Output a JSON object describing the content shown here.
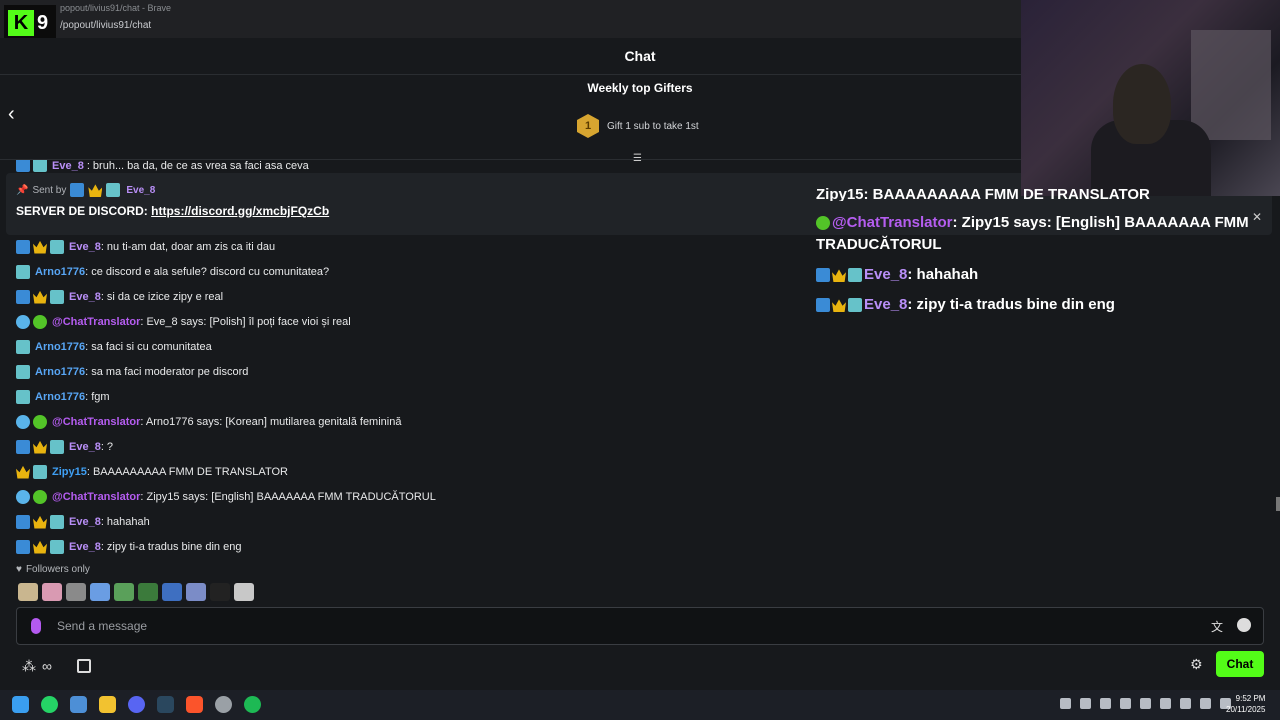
{
  "browser": {
    "title": "popout/livius91/chat - Brave",
    "url": "/popout/livius91/chat",
    "logo_number": "9"
  },
  "header": {
    "title": "Chat"
  },
  "gifters": {
    "title": "Weekly top Gifters",
    "medal": "1",
    "cta": "Gift 1 sub to take 1st"
  },
  "cutoff": {
    "user": "Eve_8",
    "text": ": bruh... ba da, de ce as vrea sa faci asa ceva"
  },
  "pinned": {
    "sent_by": "Sent by",
    "user": "Eve_8",
    "text": "SERVER DE DISCORD: ",
    "link": "https://discord.gg/xmcbjFQzCb"
  },
  "messages": [
    {
      "user": "Eve_8",
      "kind": "eve",
      "text": ": nu ti-am dat, doar am zis ca iti dau"
    },
    {
      "user": "Arno1776",
      "kind": "arno",
      "text": ": ce discord e ala sefule? discord cu comunitatea?"
    },
    {
      "user": "Eve_8",
      "kind": "eve",
      "text": ": si da ce izice zipy e real"
    },
    {
      "user": "@ChatTranslator",
      "kind": "bot",
      "text": ": Eve_8 says: [Polish] îl poți face vioi și real"
    },
    {
      "user": "Arno1776",
      "kind": "arno",
      "text": ": sa faci si cu comunitatea"
    },
    {
      "user": "Arno1776",
      "kind": "arno",
      "text": ": sa ma faci moderator pe discord"
    },
    {
      "user": "Arno1776",
      "kind": "arno",
      "text": ": fgm"
    },
    {
      "user": "@ChatTranslator",
      "kind": "bot",
      "text": ": Arno1776 says: [Korean] mutilarea genitală feminină"
    },
    {
      "user": "Eve_8",
      "kind": "eve",
      "text": ": ?"
    },
    {
      "user": "Zipy15",
      "kind": "zipy",
      "text": ": BAAAAAAAAA FMM DE TRANSLATOR"
    },
    {
      "user": "@ChatTranslator",
      "kind": "bot",
      "text": ": Zipy15 says: [English] BAAAAAAA FMM TRADUCĂTORUL"
    },
    {
      "user": "Eve_8",
      "kind": "eve",
      "text": ": hahahah"
    },
    {
      "user": "Eve_8",
      "kind": "eve",
      "text": ": zipy ti-a tradus bine din eng"
    }
  ],
  "followers_only": "Followers only",
  "input": {
    "placeholder": "Send a message"
  },
  "footer": {
    "chat_button": "Chat"
  },
  "overlay": {
    "cut": "Zipy15: BAAAAAAAAA FMM DE TRANSLATOR",
    "rows": [
      {
        "user": "@ChatTranslator",
        "text": " Zipy15 says: [English] BAAAAAAA FMM TRADUCĂTORUL"
      },
      {
        "user": "Eve_8",
        "text": " hahahah"
      },
      {
        "user": "Eve_8",
        "text": " zipy ti-a tradus bine din eng"
      }
    ]
  },
  "clock": {
    "time": "9:52 PM",
    "date": "20/11/2025"
  },
  "colors": {
    "accent": "#53fc18",
    "eve": "#b98ff7",
    "arno": "#58a6f5",
    "bot": "#b55df0"
  }
}
